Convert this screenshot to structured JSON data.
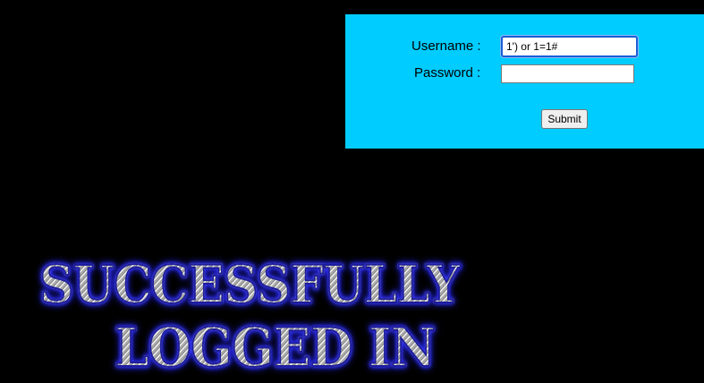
{
  "login_form": {
    "username_label": "Username :",
    "password_label": "Password :",
    "username_value": "1') or 1=1#",
    "password_value": "",
    "submit_label": "Submit"
  },
  "result": {
    "line_one": "SUCCESSFULLY",
    "line_two": "LOGGED IN"
  },
  "colors": {
    "background": "#000000",
    "panel": "#00ccff",
    "banner_glow": "#2424ff",
    "focus_border": "#1a5fd6"
  }
}
